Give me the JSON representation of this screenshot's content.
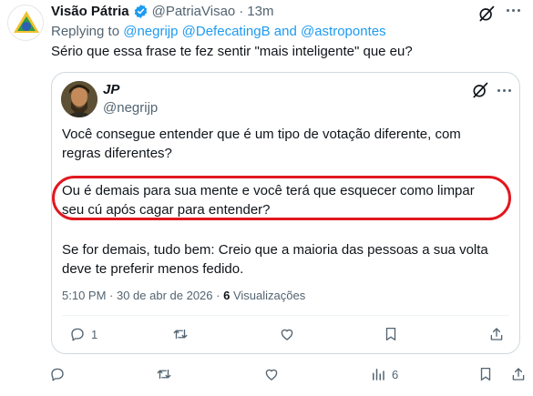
{
  "outer_tweet": {
    "display_name": "Visão Pátria",
    "handle": "@PatriaVisao",
    "separator": "·",
    "time": "13m",
    "replying_label": "Replying to",
    "mention_1": "@negrijp",
    "mention_2": "@DefecatingB",
    "and_text": "and",
    "mention_3": "@astropontes",
    "text": "Sério que essa frase te fez sentir \"mais inteligente\" que eu?",
    "actions": {
      "reply_count": "",
      "retweet_count": "",
      "like_count": "",
      "views_count": "6"
    }
  },
  "quoted_tweet": {
    "display_name": "JP",
    "handle": "@negrijp",
    "paragraph_1": "Você consegue entender que é um tipo de votação diferente, com regras diferentes?",
    "paragraph_2": "Ou é demais para sua mente e você terá que esquecer como limpar seu cú após cagar para entender?",
    "paragraph_3": "Se for demais, tudo bem: Creio que a maioria das pessoas a sua volta deve te preferir menos fedido.",
    "timestamp": "5:10 PM · 30 de abr de 2026 ·",
    "views_count": "6",
    "views_label": "Visualizações",
    "actions": {
      "reply_count": "1"
    }
  },
  "colors": {
    "highlight_border": "#e0181f",
    "link": "#1d9bf0",
    "muted": "#536471",
    "verified_badge": "#1d9bf0"
  },
  "icons": [
    "avatar",
    "verified-badge",
    "grok-icon",
    "reply-icon",
    "retweet-icon",
    "like-icon",
    "bookmark-icon",
    "share-icon",
    "analytics-icon"
  ]
}
